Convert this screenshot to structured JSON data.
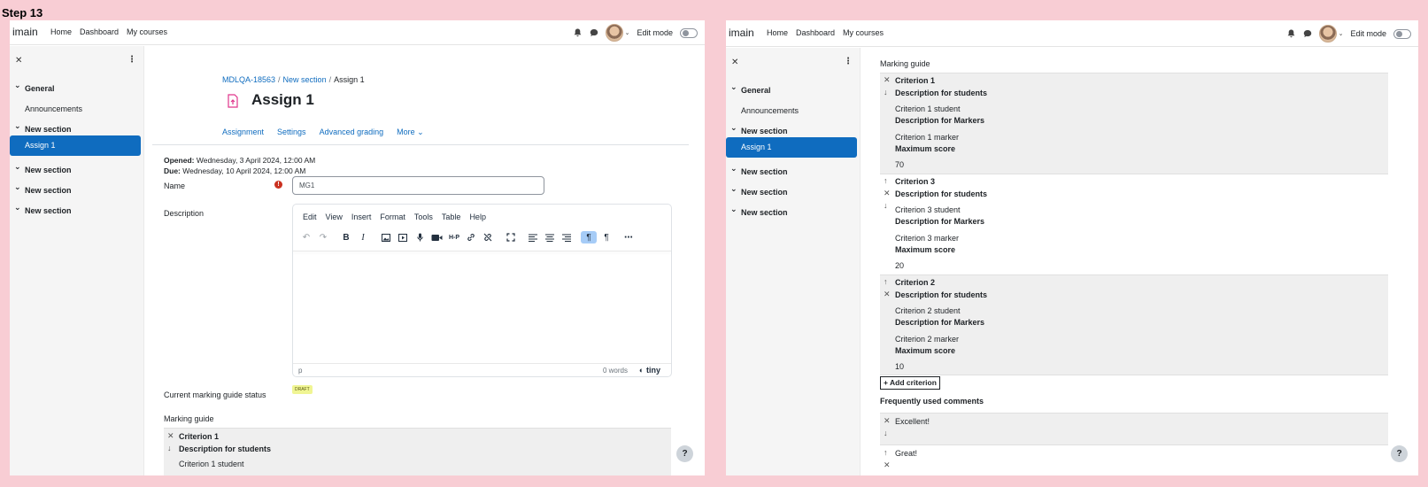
{
  "step_label": "Step 13",
  "navbar": {
    "brand": "imain",
    "links": [
      "Home",
      "Dashboard",
      "My courses"
    ],
    "edit_mode": "Edit mode"
  },
  "drawer": {
    "sections": [
      {
        "label": "General",
        "items": [
          "Announcements"
        ]
      },
      {
        "label": "New section",
        "items": [
          "Assign 1"
        ]
      },
      {
        "label": "New section",
        "items": []
      },
      {
        "label": "New section",
        "items": []
      },
      {
        "label": "New section",
        "items": []
      }
    ],
    "active_item": "Assign 1"
  },
  "breadcrumb": [
    "MDLQA-18563",
    "New section",
    "Assign 1"
  ],
  "page_title": "Assign 1",
  "tabs": [
    "Assignment",
    "Settings",
    "Advanced grading",
    "More ⌄"
  ],
  "dates": {
    "opened_label": "Opened:",
    "opened_value": "Wednesday, 3 April 2024, 12:00 AM",
    "due_label": "Due:",
    "due_value": "Wednesday, 10 April 2024, 12:00 AM"
  },
  "form": {
    "name_label": "Name",
    "name_value": "MG1",
    "description_label": "Description",
    "editor_menu": [
      "Edit",
      "View",
      "Insert",
      "Format",
      "Tools",
      "Table",
      "Help"
    ],
    "editor_status_path": "p",
    "editor_word_count": "0 words",
    "editor_brand": "tiny",
    "status_label": "Current marking guide status",
    "status_badge": "DRAFT"
  },
  "marking_guide_label": "Marking guide",
  "criteria": [
    {
      "name": "Criterion 1",
      "desc_students_label": "Description for students",
      "desc_students": "Criterion 1 student",
      "desc_markers_label": "Description for Markers",
      "desc_markers": "Criterion 1 marker",
      "max_label": "Maximum score",
      "max": "70"
    },
    {
      "name": "Criterion 3",
      "desc_students_label": "Description for students",
      "desc_students": "Criterion 3 student",
      "desc_markers_label": "Description for Markers",
      "desc_markers": "Criterion 3 marker",
      "max_label": "Maximum score",
      "max": "20"
    },
    {
      "name": "Criterion 2",
      "desc_students_label": "Description for students",
      "desc_students": "Criterion 2 student",
      "desc_markers_label": "Description for Markers",
      "desc_markers": "Criterion 2 marker",
      "max_label": "Maximum score",
      "max": "10"
    }
  ],
  "add_criterion": "Add criterion",
  "frequent_comments_title": "Frequently used comments",
  "comments": [
    "Excellent!",
    "Great!"
  ],
  "help_label": "?",
  "icons": {
    "close": "✕",
    "kebab": "⋮",
    "delete": "✕",
    "up": "↑",
    "down": "↓",
    "plus": "+"
  }
}
